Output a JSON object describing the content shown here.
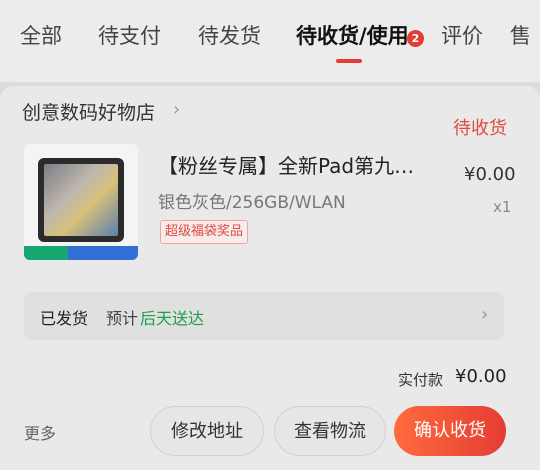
{
  "tabs": [
    {
      "label": "全部"
    },
    {
      "label": "待支付"
    },
    {
      "label": "待发货"
    },
    {
      "label": "待收货/使用",
      "badge": "2"
    },
    {
      "label": "评价"
    },
    {
      "label": "售"
    }
  ],
  "order": {
    "store_name": "创意数码好物店",
    "status": "待收货",
    "product": {
      "title": "【粉丝专属】全新Pad第九…",
      "price": "¥0.00",
      "spec": "银色灰色/256GB/WLAN",
      "quantity": "x1",
      "tag": "超级福袋奖品"
    },
    "logistics": {
      "status": "已发货",
      "eta_label": "预计",
      "eta_value": "后天送达"
    },
    "payment": {
      "label": "实付款",
      "amount": "¥0.00"
    },
    "actions": {
      "more": "更多",
      "change_address": "修改地址",
      "view_logistics": "查看物流",
      "confirm_receipt": "确认收货"
    }
  },
  "colors": {
    "accent": "#e43d33",
    "eta": "#1f9e4a"
  }
}
